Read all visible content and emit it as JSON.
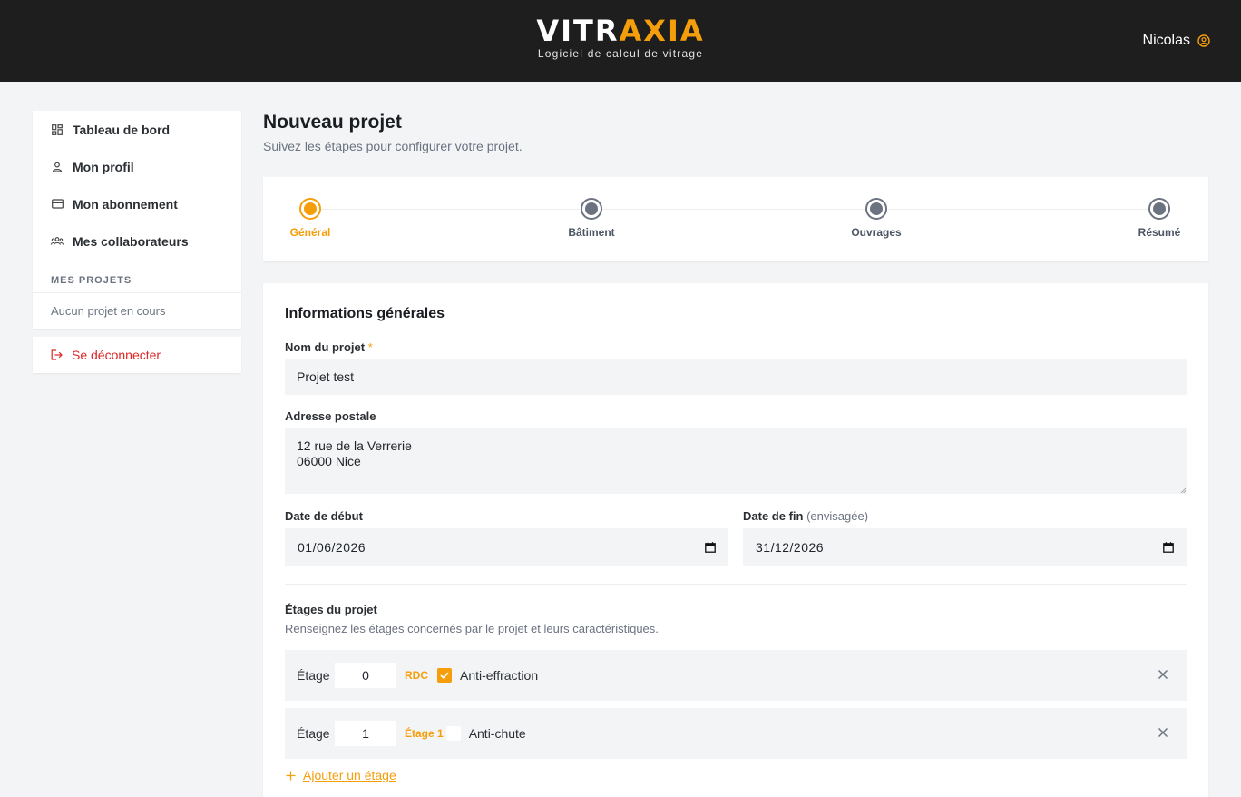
{
  "header": {
    "brand_part1": "VITR",
    "brand_part2": "AXIA",
    "tagline": "Logiciel de calcul de vitrage",
    "user_name": "Nicolas",
    "user_icon": "user-circle-icon"
  },
  "sidebar": {
    "items": [
      {
        "label": "Tableau de bord",
        "icon": "dashboard-icon"
      },
      {
        "label": "Mon profil",
        "icon": "user-icon"
      },
      {
        "label": "Mon abonnement",
        "icon": "credit-card-icon"
      },
      {
        "label": "Mes collaborateurs",
        "icon": "users-icon"
      }
    ],
    "projects_section_label": "MES PROJETS",
    "projects_empty": "Aucun projet en cours",
    "logout_label": "Se déconnecter"
  },
  "page": {
    "title": "Nouveau projet",
    "subtitle": "Suivez les étapes pour configurer votre projet."
  },
  "stepper": {
    "steps": [
      {
        "label": "Général",
        "active": true
      },
      {
        "label": "Bâtiment",
        "active": false
      },
      {
        "label": "Ouvrages",
        "active": false
      },
      {
        "label": "Résumé",
        "active": false
      }
    ]
  },
  "form": {
    "section_title": "Informations générales",
    "project_name_label": "Nom du projet",
    "required_mark": "*",
    "project_name_value": "Projet test",
    "address_label": "Adresse postale",
    "address_line1": "12 rue de la Verrerie",
    "address_line2": "06000 Nice",
    "start_date_label": "Date de début",
    "start_date_value": "01/06/2026",
    "end_date_label": "Date de fin",
    "end_date_hint": "(envisagée)",
    "end_date_value": "31/12/2026",
    "floors_title": "Étages du projet",
    "floors_desc": "Renseignez les étages concernés par le projet et leurs caractéristiques.",
    "floors": [
      {
        "label": "Étage",
        "number": "0",
        "tag": "RDC",
        "checked": true,
        "option": "Anti-effraction"
      },
      {
        "label": "Étage",
        "number": "1",
        "tag": "Étage 1",
        "checked": false,
        "option": "Anti-chute"
      }
    ],
    "add_floor_label": "Ajouter un étage"
  },
  "colors": {
    "accent": "#f59e0b",
    "header_bg": "#1e1e1e",
    "danger": "#dc2626",
    "page_bg": "#f3f4f6"
  }
}
